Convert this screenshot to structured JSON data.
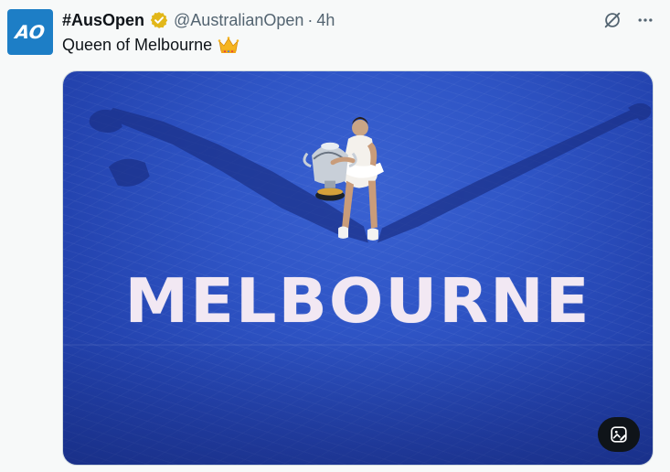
{
  "tweet": {
    "avatar_text": "AO",
    "display_name": "#AusOpen",
    "handle": "@AustralianOpen",
    "separator": "·",
    "time": "4h",
    "text": "Queen of Melbourne",
    "media": {
      "court_text": "MELBOURNE"
    }
  },
  "icons": {
    "verified": "verified-badge-icon",
    "crown": "crown-emoji",
    "grok": "grok-icon",
    "more": "more-icon",
    "alt": "image-edit-icon"
  },
  "colors": {
    "accent": "#1d9bf0",
    "badge_gold": "#e2b719",
    "avatar_bg": "#1d7ec6",
    "court_blue": "#2f55c6",
    "secondary_text": "#536471"
  }
}
